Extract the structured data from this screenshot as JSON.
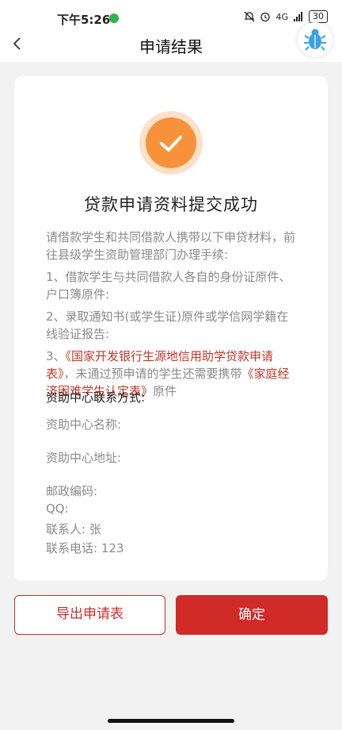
{
  "status_bar": {
    "time": "下午5:26",
    "battery": "30",
    "network": "4G"
  },
  "nav": {
    "title": "申请结果"
  },
  "result": {
    "title": "贷款申请资料提交成功",
    "intro": "请借款学生和共同借款人携带以下申贷材料，前往县级学生资助管理部门办理手续:",
    "item1": "1、借款学生与共同借款人各自的身份证原件、户口簿原件:",
    "item2": "2、录取通知书(或学生证)原件或学信网学籍在线验证报告:",
    "item3_prefix": "3、",
    "item3_red1": "《国家开发银行生源地信用助学贷款申请表》",
    "item3_mid": "，未通过预申请的学生还需要携带",
    "item3_red2": "《家庭经济困难学生认定表》",
    "item3_suffix": "原件"
  },
  "contact": {
    "heading": "资助中心联系方式:",
    "name_label": "资助中心名称:",
    "address_label": "资助中心地址:",
    "postcode_label": "邮政编码:",
    "qq_label": "QQ:",
    "person_label": "联系人: 张",
    "phone_label": "联系电话: 123"
  },
  "buttons": {
    "export": "导出申请表",
    "confirm": "确定"
  },
  "colors": {
    "accent_red": "#d02b27",
    "check_orange": "#f7923a"
  }
}
